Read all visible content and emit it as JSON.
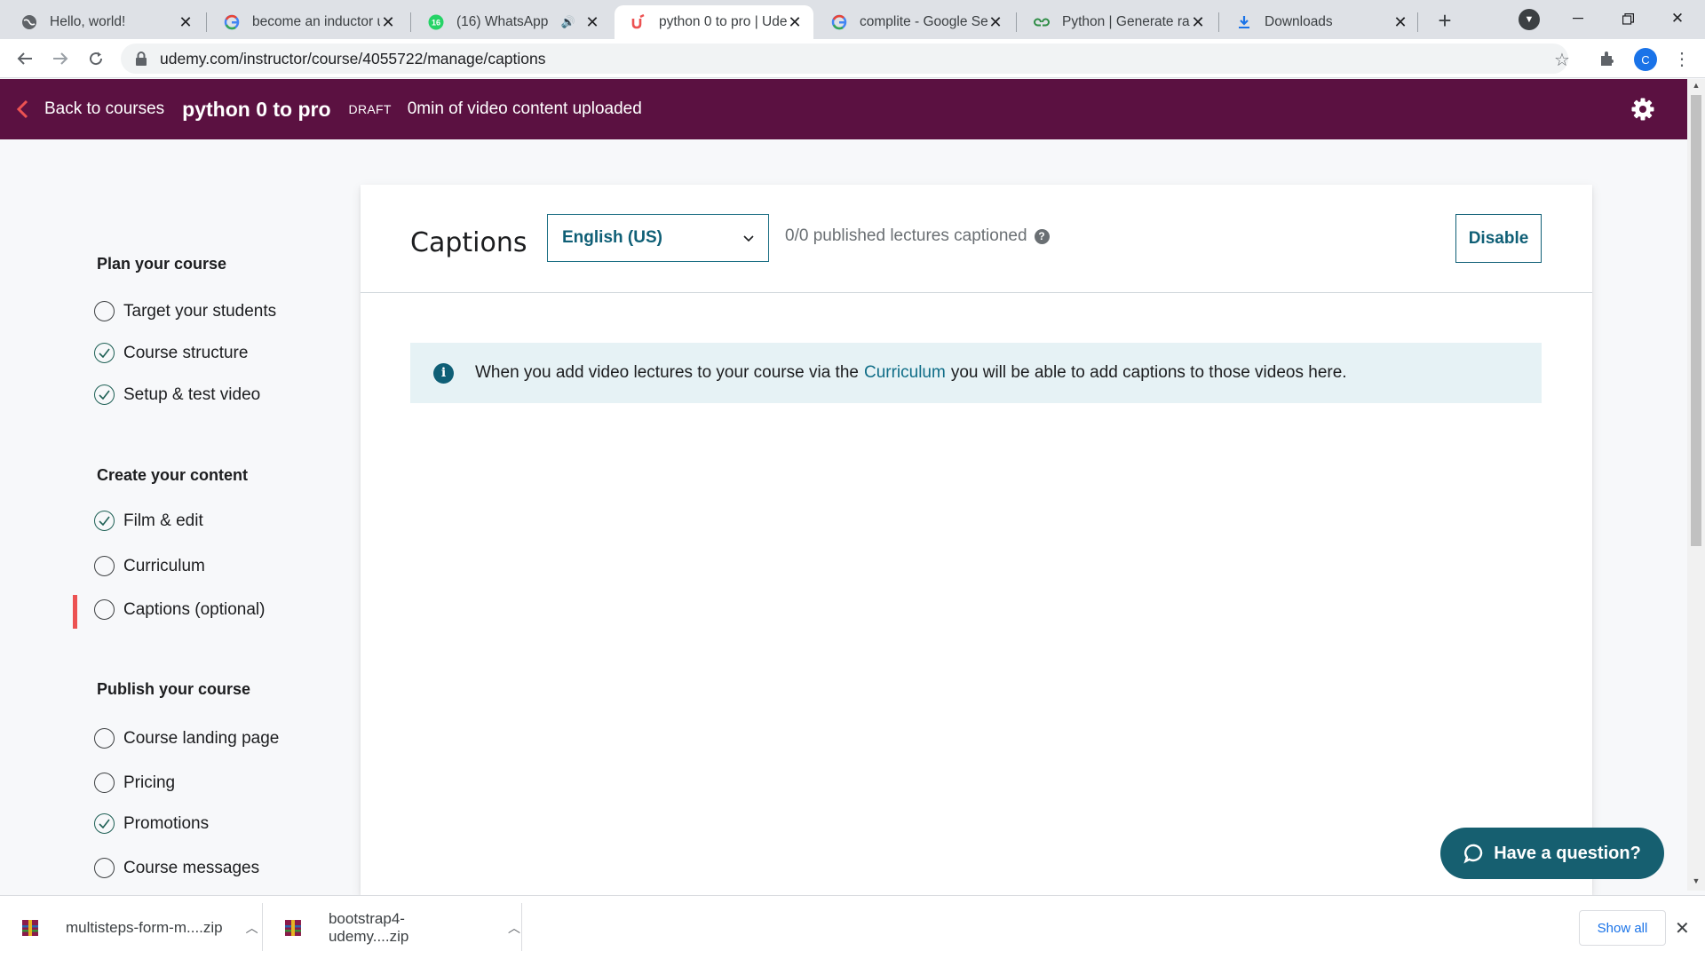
{
  "browser": {
    "tabs": [
      {
        "title": "Hello, world!",
        "icon": "globe-icon",
        "active": false
      },
      {
        "title": "become an inductor u",
        "icon": "google-icon",
        "active": false
      },
      {
        "title": "(16) WhatsApp",
        "icon": "whatsapp-icon",
        "badge": "16",
        "audio": "🔊",
        "active": false
      },
      {
        "title": "python 0 to pro | Ude",
        "icon": "udemy-icon",
        "active": true
      },
      {
        "title": "complite - Google Sea",
        "icon": "google-icon",
        "active": false
      },
      {
        "title": "Python | Generate ran",
        "icon": "geeks-icon",
        "active": false
      },
      {
        "title": "Downloads",
        "icon": "download-icon",
        "active": false
      }
    ],
    "url": "udemy.com/instructor/course/4055722/manage/captions",
    "profile_initial": "C"
  },
  "header": {
    "back_label": "Back to courses",
    "course_title": "python 0 to pro",
    "status": "DRAFT",
    "uploaded": "0min of video content uploaded"
  },
  "sidebar": {
    "sections": [
      {
        "heading": "Plan your course",
        "items": [
          {
            "label": "Target your students",
            "done": false
          },
          {
            "label": "Course structure",
            "done": true
          },
          {
            "label": "Setup & test video",
            "done": true
          }
        ]
      },
      {
        "heading": "Create your content",
        "items": [
          {
            "label": "Film & edit",
            "done": true
          },
          {
            "label": "Curriculum",
            "done": false
          },
          {
            "label": "Captions (optional)",
            "done": false,
            "active": true
          }
        ]
      },
      {
        "heading": "Publish your course",
        "items": [
          {
            "label": "Course landing page",
            "done": false
          },
          {
            "label": "Pricing",
            "done": false
          },
          {
            "label": "Promotions",
            "done": true
          },
          {
            "label": "Course messages",
            "done": false
          }
        ]
      }
    ]
  },
  "main": {
    "title": "Captions",
    "language": "English (US)",
    "captioned_status": "0/0 published lectures captioned",
    "disable_label": "Disable",
    "alert": {
      "before": "When you add video lectures to your course via the",
      "link": "Curriculum",
      "after": "you will be able to add captions to those videos here."
    }
  },
  "help": {
    "label": "Have a question?"
  },
  "downloads": {
    "files": [
      {
        "name": "multisteps-form-m....zip"
      },
      {
        "name": "bootstrap4-udemy....zip"
      }
    ],
    "show_all": "Show all"
  },
  "colors": {
    "header_bg": "#5b1141",
    "accent": "#0f5f76",
    "active_marker": "#ec5252",
    "alert_bg": "#e6f2f5",
    "help_button": "#165f70"
  }
}
